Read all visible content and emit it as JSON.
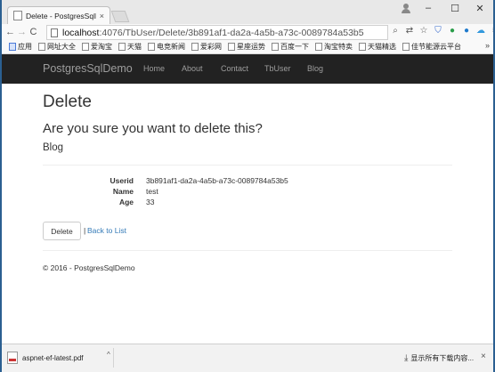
{
  "browser": {
    "tab_title": "Delete - PostgresSqlDe",
    "tab_close": "×",
    "window_controls": {
      "minimize": "–",
      "maximize": "☐",
      "close": "✕"
    },
    "nav": {
      "back": "←",
      "forward": "→",
      "reload": "C"
    },
    "url_host": "localhost",
    "url_path": ":4076/TbUser/Delete/3b891af1-da2a-4a5b-a73c-0089784a53b5",
    "toolbar_icons": [
      "search-icon",
      "translate-icon",
      "star-icon",
      "shield-icon",
      "refresh-extension-icon",
      "circle-extension-icon",
      "cloud-extension-icon",
      "menu-icon"
    ],
    "bookmarks": [
      {
        "label": "应用",
        "icon": "apps-icon"
      },
      {
        "label": "网址大全",
        "icon": "page-icon"
      },
      {
        "label": "爱淘宝",
        "icon": "page-icon"
      },
      {
        "label": "天猫",
        "icon": "page-icon"
      },
      {
        "label": "电竞新闻",
        "icon": "page-icon"
      },
      {
        "label": "爱彩网",
        "icon": "page-icon"
      },
      {
        "label": "星座运势",
        "icon": "page-icon"
      },
      {
        "label": "百度一下",
        "icon": "page-icon"
      },
      {
        "label": "淘宝特卖",
        "icon": "page-icon"
      },
      {
        "label": "天猫精选",
        "icon": "page-icon"
      },
      {
        "label": "佳节能源云平台",
        "icon": "page-icon"
      }
    ],
    "bookmarks_more": "»"
  },
  "site": {
    "brand": "PostgresSqlDemo",
    "nav_links": [
      "Home",
      "About",
      "Contact",
      "TbUser",
      "Blog"
    ]
  },
  "page": {
    "title": "Delete",
    "question": "Are you sure you want to delete this?",
    "entity": "Blog",
    "fields": [
      {
        "label": "Userid",
        "value": "3b891af1-da2a-4a5b-a73c-0089784a53b5"
      },
      {
        "label": "Name",
        "value": "test"
      },
      {
        "label": "Age",
        "value": "33"
      }
    ],
    "delete_button": "Delete",
    "separator": "|",
    "back_link": "Back to List",
    "footer": "© 2016 - PostgresSqlDemo"
  },
  "downloads": {
    "file_name": "aspnet-ef-latest.pdf",
    "caret": "^",
    "show_all": "显示所有下载内容...",
    "close": "×"
  },
  "colors": {
    "navbar_bg": "#222222",
    "navbar_text": "#9d9d9d",
    "link": "#337ab7",
    "frame": "#2b5f91"
  }
}
